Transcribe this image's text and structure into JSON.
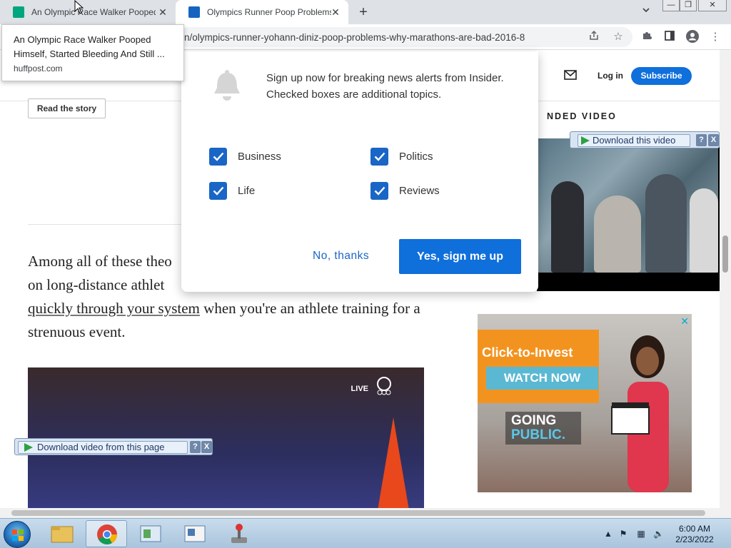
{
  "browser": {
    "tabs": [
      {
        "title": "An Olympic Race Walker Pooped Himself",
        "icon": "huffpost-favicon"
      },
      {
        "title": "Olympics Runner Poop Problems",
        "icon": "insider-favicon"
      }
    ],
    "url": "n/olympics-runner-yohann-diniz-poop-problems-why-marathons-are-bad-2016-8",
    "window_controls": {
      "minimize": "—",
      "maximize": "❐",
      "close": "✕"
    }
  },
  "hover_card": {
    "title": "An Olympic Race Walker Pooped Himself, Started Bleeding And Still ...",
    "domain": "huffpost.com"
  },
  "site_header": {
    "login": "Log in",
    "subscribe": "Subscribe"
  },
  "article": {
    "read_story": "Read the story",
    "para_part1": "Among all of these theo",
    "para_part2": "on long-distance athlet",
    "link_text": "quickly through your system",
    "para_part3": " when you're an athlete training for a strenuous event."
  },
  "sidebar": {
    "heading": "NDED VIDEO"
  },
  "download_overlay": {
    "label": "Download this video",
    "help": "?",
    "close": "X"
  },
  "download_bar": {
    "label": "Download video from this page",
    "help": "?",
    "close": "X"
  },
  "ad": {
    "headline": "Click-to-Invest",
    "cta": "WATCH NOW",
    "brand_line1": "GOING",
    "brand_line2": "PUBLIC.",
    "close": "✕"
  },
  "video": {
    "live_badge": "LIVE"
  },
  "modal": {
    "message": "Sign up now for breaking news alerts from Insider. Checked boxes are additional topics.",
    "checkboxes": [
      "Business",
      "Politics",
      "Life",
      "Reviews"
    ],
    "no_thanks": "No, thanks",
    "yes": "Yes, sign me up"
  },
  "taskbar": {
    "time": "6:00 AM",
    "date": "2/23/2022"
  },
  "colors": {
    "brand_blue": "#0f6fdb",
    "checkbox_blue": "#1966c6",
    "ad_orange": "#f3931f"
  }
}
